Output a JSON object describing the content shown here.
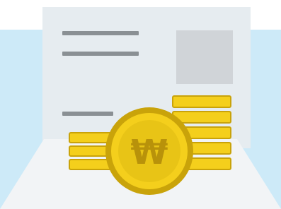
{
  "illustration": {
    "background_color": "#cdeaf8",
    "paper_color": "#e6ecf0",
    "tray_color": "#f2f4f6",
    "text_line_color": "#8a9094",
    "photo_color": "#d0d4d8",
    "coin_face": "#f4cf1c",
    "coin_edge": "#c9a30a",
    "coin_shadow": "#b8920a",
    "coin_symbol": "₩",
    "icons": [
      "document-icon",
      "won-coin-icon",
      "coin-stack-icon",
      "envelope-tray-icon"
    ]
  }
}
